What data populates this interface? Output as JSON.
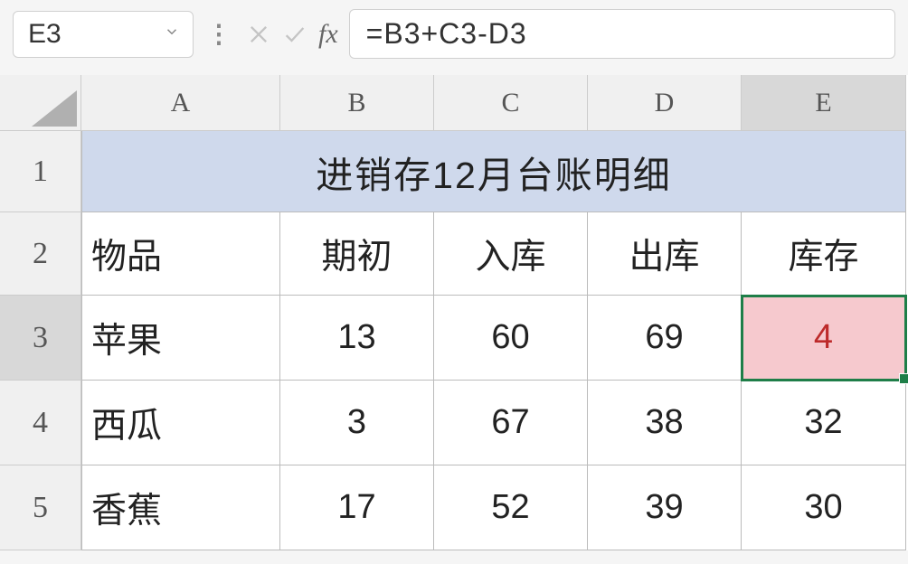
{
  "formula_bar": {
    "cell_ref": "E3",
    "formula": "=B3+C3-D3"
  },
  "columns": [
    "A",
    "B",
    "C",
    "D",
    "E"
  ],
  "rows": [
    "1",
    "2",
    "3",
    "4",
    "5"
  ],
  "selected_col": "E",
  "selected_row": "3",
  "title": "进销存12月台账明细",
  "headers": {
    "item": "物品",
    "begin": "期初",
    "in": "入库",
    "out": "出库",
    "stock": "库存"
  },
  "data": [
    {
      "item": "苹果",
      "begin": "13",
      "in": "60",
      "out": "69",
      "stock": "4"
    },
    {
      "item": "西瓜",
      "begin": "3",
      "in": "67",
      "out": "38",
      "stock": "32"
    },
    {
      "item": "香蕉",
      "begin": "17",
      "in": "52",
      "out": "39",
      "stock": "30"
    }
  ]
}
